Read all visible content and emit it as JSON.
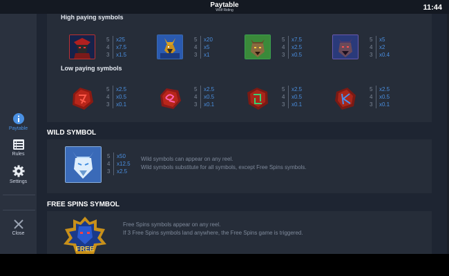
{
  "header": {
    "title": "Paytable",
    "subtitle": "Wolf Riding",
    "clock": "11:44"
  },
  "sidebar": {
    "items": [
      {
        "label": "Paytable",
        "icon": "info-icon",
        "active": true
      },
      {
        "label": "Rules",
        "icon": "rules-list-icon",
        "active": false
      },
      {
        "label": "Settings",
        "icon": "gear-icon",
        "active": false
      }
    ],
    "close_label": "Close"
  },
  "paytable": {
    "high_title": "High paying symbols",
    "high": [
      {
        "icon": "samurai-warrior-icon",
        "pays": [
          {
            "count": "5",
            "mult": "x25"
          },
          {
            "count": "4",
            "mult": "x7.5"
          },
          {
            "count": "3",
            "mult": "x1.5"
          }
        ]
      },
      {
        "icon": "anubis-jackal-icon",
        "pays": [
          {
            "count": "5",
            "mult": "x20"
          },
          {
            "count": "4",
            "mult": "x5"
          },
          {
            "count": "3",
            "mult": "x1"
          }
        ]
      },
      {
        "icon": "werewolf-green-icon",
        "pays": [
          {
            "count": "5",
            "mult": "x7.5"
          },
          {
            "count": "4",
            "mult": "x2.5"
          },
          {
            "count": "3",
            "mult": "x0.5"
          }
        ]
      },
      {
        "icon": "werewolf-purple-icon",
        "pays": [
          {
            "count": "5",
            "mult": "x5"
          },
          {
            "count": "4",
            "mult": "x2"
          },
          {
            "count": "3",
            "mult": "x0.4"
          }
        ]
      }
    ],
    "low_title": "Low paying symbols",
    "low": [
      {
        "icon": "rune-stone-red-icon",
        "pays": [
          {
            "count": "5",
            "mult": "x2.5"
          },
          {
            "count": "4",
            "mult": "x0.5"
          },
          {
            "count": "3",
            "mult": "x0.1"
          }
        ]
      },
      {
        "icon": "rune-stone-pink-icon",
        "pays": [
          {
            "count": "5",
            "mult": "x2.5"
          },
          {
            "count": "4",
            "mult": "x0.5"
          },
          {
            "count": "3",
            "mult": "x0.1"
          }
        ]
      },
      {
        "icon": "rune-stone-green-icon",
        "pays": [
          {
            "count": "5",
            "mult": "x2.5"
          },
          {
            "count": "4",
            "mult": "x0.5"
          },
          {
            "count": "3",
            "mult": "x0.1"
          }
        ]
      },
      {
        "icon": "rune-stone-blue-icon",
        "pays": [
          {
            "count": "5",
            "mult": "x2.5"
          },
          {
            "count": "4",
            "mult": "x0.5"
          },
          {
            "count": "3",
            "mult": "x0.1"
          }
        ]
      }
    ]
  },
  "wild": {
    "title": "WILD SYMBOL",
    "icon": "wild-ice-wolf-icon",
    "pays": [
      {
        "count": "5",
        "mult": "x50"
      },
      {
        "count": "4",
        "mult": "x12.5"
      },
      {
        "count": "3",
        "mult": "x2.5"
      }
    ],
    "desc1": "Wild symbols can appear on any reel.",
    "desc2": "Wild symbols substitute for all symbols, except Free Spins symbols."
  },
  "free_spins": {
    "title": "FREE SPINS SYMBOL",
    "icon": "free-spins-emblem-icon",
    "badge": "FREE",
    "desc1": "Free Spins symbols appear on any reel.",
    "desc2": "If 3 Free Spins symbols land anywhere, the Free Spins game is triggered."
  },
  "colors": {
    "accent": "#4a90e2",
    "background": "#1e2532",
    "panel": "#262d39",
    "sidebar": "#2a313e"
  }
}
